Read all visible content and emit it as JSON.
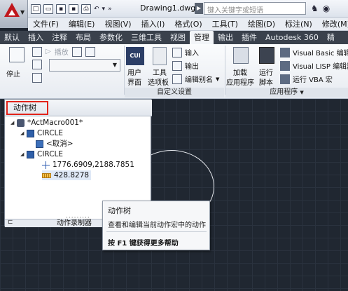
{
  "titlebar": {
    "document_title": "Drawing1.dwg",
    "search_placeholder": "键入关键字或短语"
  },
  "menubar": {
    "items": [
      "文件(F)",
      "编辑(E)",
      "视图(V)",
      "插入(I)",
      "格式(O)",
      "工具(T)",
      "绘图(D)",
      "标注(N)",
      "修改(M)"
    ]
  },
  "ribbon_tabs": {
    "items": [
      "默认",
      "插入",
      "注释",
      "布局",
      "参数化",
      "三维工具",
      "视图",
      "管理",
      "输出",
      "插件",
      "Autodesk 360",
      "精"
    ],
    "active": "管理"
  },
  "ribbon": {
    "stop_label": "停止",
    "play_label": "播放",
    "user_interface_label_1": "用户",
    "user_interface_label_2": "界面",
    "tool_palette_label_1": "工具",
    "tool_palette_label_2": "选项板",
    "import_label": "输入",
    "export_label": "输出",
    "edit_alias_label": "编辑别名",
    "customization_group": "自定义设置",
    "load_app_label_1": "加载",
    "load_app_label_2": "应用程序",
    "run_script_label_1": "运行",
    "run_script_label_2": "脚本",
    "vb_editor_label": "Visual Basic 编辑器",
    "vlisp_editor_label": "Visual LISP 编辑器",
    "run_vba_label": "运行 VBA 宏",
    "applications_group": "应用程序"
  },
  "palette": {
    "title": "动作树",
    "macro_name": "*ActMacro001*",
    "node1": "CIRCLE",
    "node1_child": "<取消>",
    "node2": "CIRCLE",
    "point_value": "1776.6909,2188.7851",
    "distance_value": "428.8278",
    "footer": "动作录制器"
  },
  "tooltip": {
    "title": "动作树",
    "description": "查看和编辑当前动作宏中的动作",
    "help": "按 F1 键获得更多帮助"
  },
  "colors": {
    "ribbon_tab_bar": "#3a414c",
    "highlight_border": "#e2231a",
    "viewport": "#202731"
  }
}
